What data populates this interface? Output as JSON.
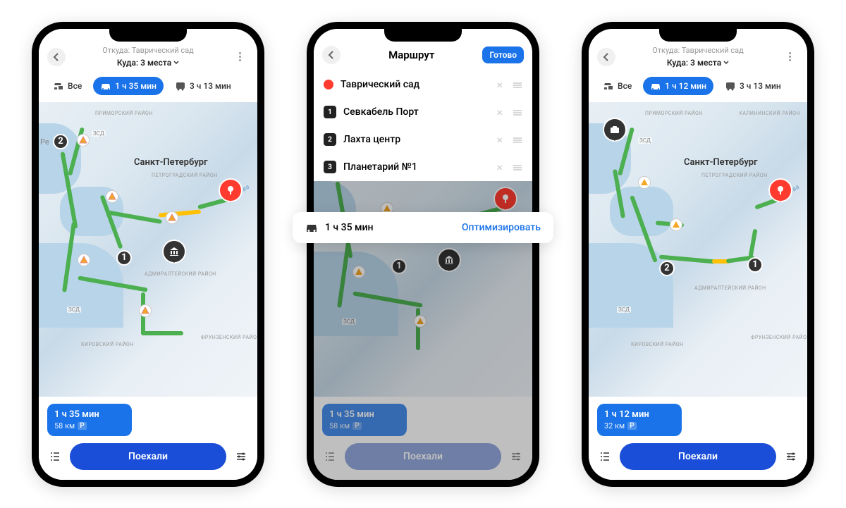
{
  "header": {
    "from_label": "Откуда: Таврический сад",
    "to_label": "Куда: 3 места"
  },
  "modes": {
    "all": "Все",
    "car_s1": "1 ч 35 мин",
    "car_s3": "1 ч 12 мин",
    "transit": "3 ч 13 мин"
  },
  "map_labels": {
    "city": "Санкт-Петербург",
    "primorsky": "ПРИМОРСКИЙ РАЙОН",
    "petrogradsky": "ПЕТРОГРАДСКИЙ РАЙОН",
    "admiralteysky": "АДМИРАЛТЕЙСКИЙ РАЙОН",
    "frunzensky": "ФРУНЗЕНСКИЙ РАЙОН",
    "kirovsky": "КИРОВСКИЙ РАЙОН",
    "kalininsky": "КАЛИНИНСКИЙ РАЙОН",
    "zsd": "ЗСД",
    "neva": "Нева",
    "re": "Ре"
  },
  "summary_s1": {
    "time": "1 ч 35 мин",
    "dist": "58 км",
    "p": "P"
  },
  "summary_s3": {
    "time": "1 ч 12 мин",
    "dist": "32 км",
    "p": "P"
  },
  "go_label": "Поехали",
  "route_screen": {
    "title": "Маршрут",
    "done": "Готово",
    "stops": [
      "Таврический сад",
      "Севкабель Порт",
      "Лахта центр",
      "Планетарий №1"
    ],
    "nums": [
      "1",
      "2",
      "3"
    ]
  },
  "optimize": {
    "time": "1 ч 35 мин",
    "action": "Оптимизировать"
  },
  "waypoints": {
    "n1": "1",
    "n2": "2"
  }
}
